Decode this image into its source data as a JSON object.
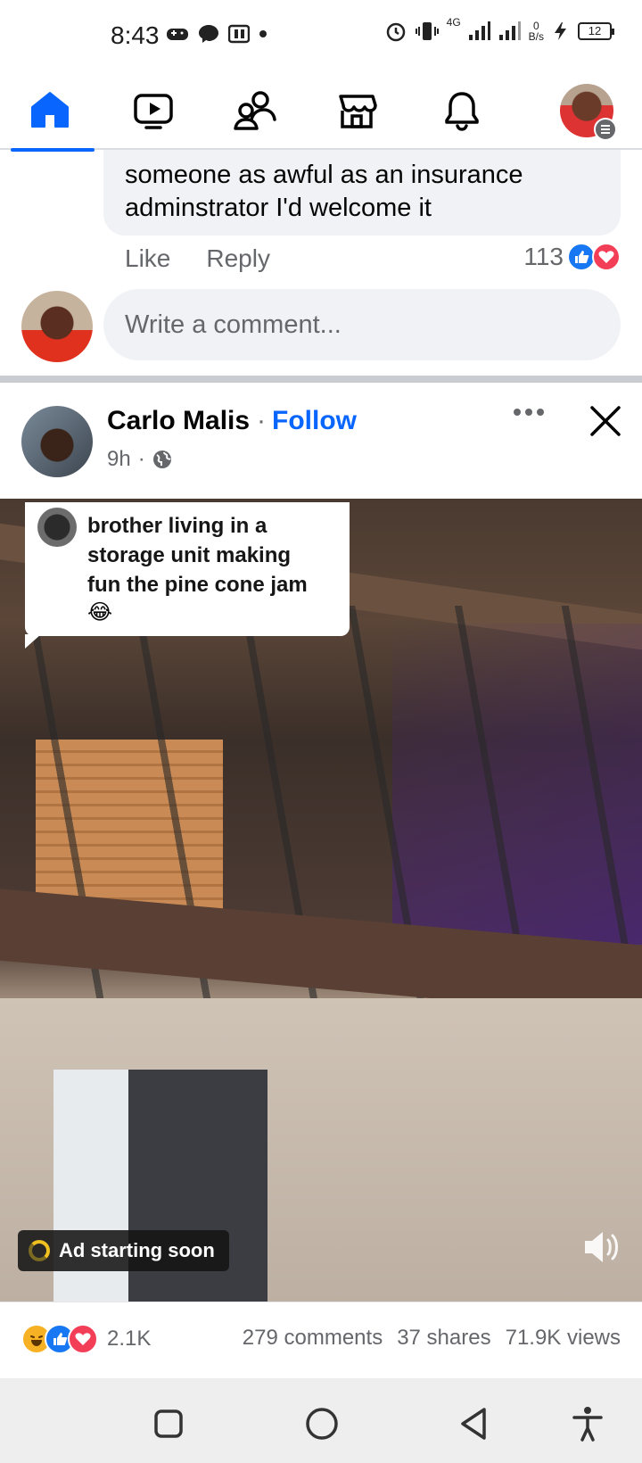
{
  "status_bar": {
    "time": "8:43",
    "network": "4G",
    "speed_value": "0",
    "speed_unit": "B/s",
    "battery": "12"
  },
  "nav": {
    "items": [
      "home",
      "video",
      "friends",
      "marketplace",
      "notifications",
      "profile-menu"
    ],
    "active": "home",
    "accent_color": "#0866ff"
  },
  "comment": {
    "text": "someone as awful as an insurance adminstrator  I'd welcome it",
    "like_label": "Like",
    "reply_label": "Reply",
    "reaction_count": "113"
  },
  "write_comment": {
    "placeholder": "Write a comment..."
  },
  "post": {
    "author": "Carlo Malis",
    "separator": "·",
    "follow_label": "Follow",
    "time": "9h",
    "time_separator": "·",
    "privacy": "globe-icon"
  },
  "video": {
    "caption_line1": "brother living in a",
    "caption_line2": "storage unit making",
    "caption_line3": "fun the pine cone jam",
    "caption_emoji": "😂",
    "ad_label": "Ad starting soon"
  },
  "stats": {
    "reaction_count": "2.1K",
    "comments": "279 comments",
    "shares": "37 shares",
    "views": "71.9K views"
  },
  "colors": {
    "brand_blue": "#0866ff",
    "love_red": "#f33e58",
    "haha_yellow": "#f7b125",
    "secondary_text": "#65676b"
  }
}
